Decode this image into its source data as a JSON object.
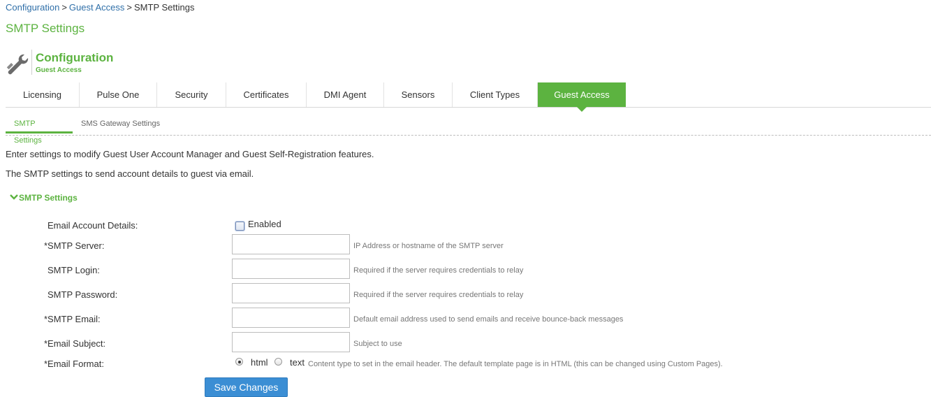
{
  "breadcrumb": {
    "items": [
      "Configuration",
      "Guest Access",
      "SMTP Settings"
    ],
    "separator": ">"
  },
  "page_title": "SMTP Settings",
  "section": {
    "title": "Configuration",
    "subtitle": "Guest Access",
    "icon": "wrench-icon"
  },
  "tabs": [
    {
      "label": "Licensing"
    },
    {
      "label": "Pulse One"
    },
    {
      "label": "Security"
    },
    {
      "label": "Certificates"
    },
    {
      "label": "DMI Agent"
    },
    {
      "label": "Sensors"
    },
    {
      "label": "Client Types"
    },
    {
      "label": "Guest Access",
      "active": true
    }
  ],
  "subtabs": [
    {
      "label": "SMTP Settings",
      "active": true
    },
    {
      "label": "SMS Gateway Settings"
    }
  ],
  "descriptions": [
    "Enter settings to modify Guest User Account Manager and Guest Self-Registration features.",
    "The SMTP settings to send account details to guest via email."
  ],
  "group": {
    "label": "SMTP Settings",
    "expanded": true
  },
  "form": {
    "email_account_details": {
      "label": "Email Account Details:",
      "checkbox_label": "Enabled",
      "checked": false
    },
    "smtp_server": {
      "label": "*SMTP Server:",
      "value": "",
      "hint": "IP Address or hostname of the SMTP server"
    },
    "smtp_login": {
      "label": "SMTP Login:",
      "value": "",
      "hint": "Required if the server requires credentials to relay"
    },
    "smtp_password": {
      "label": "SMTP Password:",
      "value": "",
      "hint": "Required if the server requires credentials to relay"
    },
    "smtp_email": {
      "label": "*SMTP Email:",
      "value": "",
      "hint": "Default email address used to send emails and receive bounce-back messages"
    },
    "email_subject": {
      "label": "*Email Subject:",
      "value": "",
      "hint": "Subject to use"
    },
    "email_format": {
      "label": "*Email Format:",
      "options": [
        "html",
        "text"
      ],
      "selected": "html",
      "hint": "Content type to set in the email header. The default template page is in HTML (this can be changed using Custom Pages)."
    }
  },
  "save_button": "Save Changes",
  "colors": {
    "accent": "#5cb340",
    "link": "#2f6fa8",
    "button": "#3b8ed4"
  }
}
